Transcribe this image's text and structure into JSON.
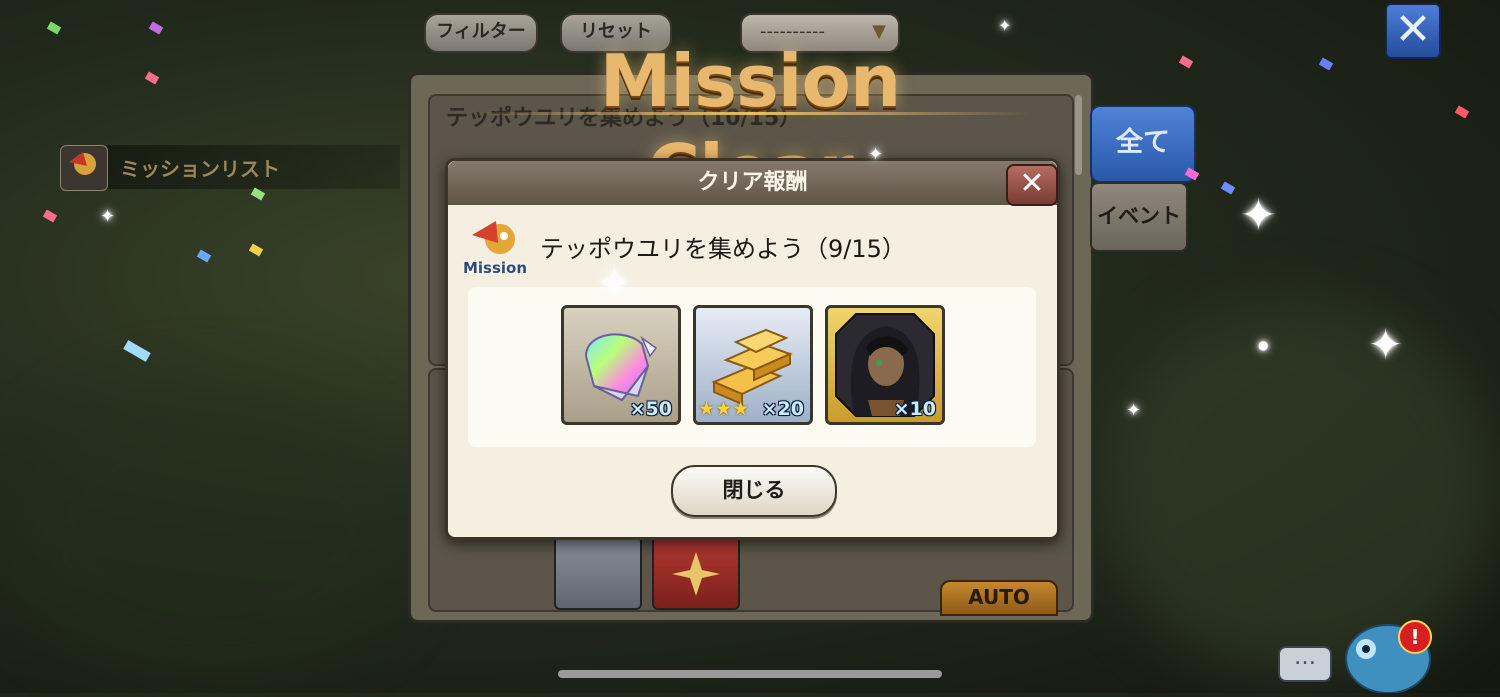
{
  "toolbar": {
    "filter_label": "フィルター",
    "reset_label": "リセット",
    "sort_value": "----------",
    "sort_arrow": "▼",
    "close_symbol": "✕"
  },
  "sidebar": {
    "mission_list_label": "ミッションリスト",
    "mission_icon_label": "Mission"
  },
  "banner": {
    "text": "Mission Clear"
  },
  "background_panel": {
    "mission_title": "テッポウユリを集めよう（10/15）",
    "tab_all": "全て",
    "tab_event": "イベント",
    "auto_label": "AUTO"
  },
  "dialog": {
    "title": "クリア報酬",
    "close_symbol": "✕",
    "mission_icon_label": "Mission",
    "mission_text": "テッポウユリを集めよう（9/15）",
    "rewards": [
      {
        "item": "rainbow-crystal",
        "qty": "×50",
        "stars": ""
      },
      {
        "item": "gold-bars",
        "qty": "×20",
        "stars": "★★★"
      },
      {
        "item": "character-portrait",
        "qty": "×10",
        "stars": ""
      }
    ],
    "close_button": "閉じる"
  },
  "hud": {
    "chat_symbol": "…",
    "alert_symbol": "!"
  },
  "colors": {
    "accent_blue": "#2a58a8",
    "banner_gold": "#e7b86e",
    "dialog_bg": "#f4efe1"
  }
}
